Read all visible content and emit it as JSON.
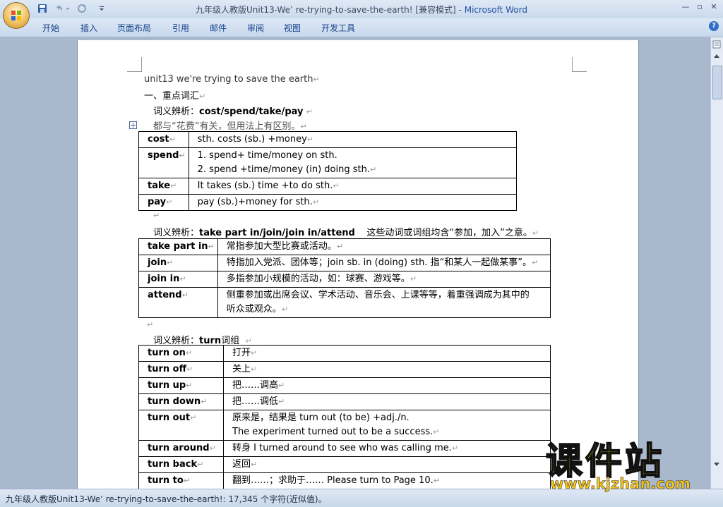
{
  "window": {
    "title": "九年级人教版Unit13-We’ re-trying-to-save-the-earth! [兼容模式]",
    "title_sep": " - ",
    "app_name": "Microsoft Word",
    "min": "—",
    "max": "▫",
    "close": "✕"
  },
  "ribbon": {
    "tabs": [
      "开始",
      "插入",
      "页面布局",
      "引用",
      "邮件",
      "审阅",
      "视图",
      "开发工具"
    ],
    "help": "?"
  },
  "doc": {
    "heading": "unit13 we're trying to save the earth",
    "section1": "一、重点词汇",
    "sub1_label": "词义辨析：",
    "sub1_words": "cost/spend/take/pay",
    "sub1_note": "都与“花费”有关，但用法上有区别。",
    "table1": [
      {
        "word": "cost",
        "usage": [
          "sth. costs (sb.) +money"
        ]
      },
      {
        "word": "spend",
        "usage": [
          "1. spend+ time/money on sth.",
          "2. spend +time/money (in) doing sth."
        ]
      },
      {
        "word": "take",
        "usage": [
          "It takes (sb.) time +to do sth."
        ]
      },
      {
        "word": "pay",
        "usage": [
          "pay (sb.)+money for sth."
        ]
      }
    ],
    "sub2_label": "词义辨析：",
    "sub2_words": "take part in/join/join in/attend",
    "sub2_note": "这些动词或词组均含“参加，加入”之意。",
    "table2": [
      {
        "word": "take part in",
        "usage": [
          "常指参加大型比赛或活动。"
        ]
      },
      {
        "word": "join",
        "usage": [
          "特指加入党派、团体等；join sb. in (doing) sth. 指“和某人一起做某事”。"
        ]
      },
      {
        "word": "join in",
        "usage": [
          "多指参加小规模的活动，如：球赛、游戏等。"
        ]
      },
      {
        "word": "attend",
        "usage": [
          "侧重参加或出席会议、学术活动、音乐会、上课等等，着重强调成为其中的",
          "听众或观众。"
        ]
      }
    ],
    "sub3_label": "词义辨析：",
    "sub3_words": "turn",
    "sub3_tail": "词组",
    "table3": [
      {
        "word": "turn on",
        "usage": [
          "打开"
        ]
      },
      {
        "word": "turn off",
        "usage": [
          "关上"
        ]
      },
      {
        "word": "turn up",
        "usage": [
          "把……调高"
        ]
      },
      {
        "word": "turn down",
        "usage": [
          "把……调低"
        ]
      },
      {
        "word": "turn out",
        "usage": [
          "原来是，结果是 turn out (to be) +adj./n.",
          "The experiment turned out to be a success."
        ]
      },
      {
        "word": "turn around",
        "usage": [
          "转身  I turned around to see who was calling me."
        ]
      },
      {
        "word": "turn back",
        "usage": [
          "返回"
        ]
      },
      {
        "word": "turn to",
        "usage": [
          "翻到……；求助于……  Please turn to Page 10."
        ]
      }
    ],
    "para_mark": "↵",
    "cell_mark": "↵"
  },
  "status": {
    "text": "九年级人教版Unit13-We’ re-trying-to-save-the-earth!: 17,345 个字符(近似值)。"
  },
  "watermark": {
    "text": "课件站",
    "url": "www.kjzhan.com"
  },
  "colors": {
    "title_app": "#1f4e9c",
    "tab_text": "#15428b",
    "watermark_fill": "#ffe21a"
  }
}
